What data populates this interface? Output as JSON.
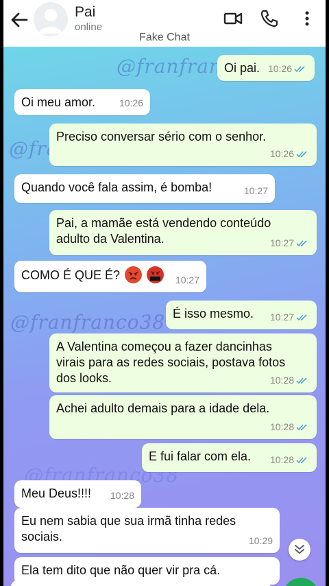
{
  "header": {
    "contact_name": "Pai",
    "status": "online",
    "subtitle": "Fake Chat"
  },
  "watermarks": [
    "@franfranco",
    "@fran",
    "@franfranco38",
    "@franfranco38"
  ],
  "messages": [
    {
      "dir": "out",
      "text": "Oi pai.",
      "time": "10:26"
    },
    {
      "dir": "in",
      "text": "Oi meu amor.",
      "time": "10:26"
    },
    {
      "dir": "out",
      "text": "Preciso conversar sério com o senhor.",
      "time": "10:26"
    },
    {
      "dir": "in",
      "text": "Quando você fala assim, é bomba!",
      "time": "10:27"
    },
    {
      "dir": "out",
      "text": "Pai, a mamãe está vendendo conteúdo adulto da Valentina.",
      "time": "10:27"
    },
    {
      "dir": "in",
      "text": "COMO É QUE É?",
      "time": "10:27",
      "emojis": [
        "angry-face-icon",
        "face-with-symbols-icon"
      ]
    },
    {
      "dir": "out",
      "text": "É isso mesmo.",
      "time": "10:27"
    },
    {
      "dir": "out",
      "text": "A Valentina começou a fazer dancinhas virais para as redes sociais, postava fotos dos looks.",
      "time": "10:28"
    },
    {
      "dir": "out",
      "text": "Achei adulto demais para a idade dela.",
      "time": "10:28"
    },
    {
      "dir": "out",
      "text": "E fui falar com ela.",
      "time": "10:28"
    },
    {
      "dir": "in",
      "text": "Meu Deus!!!!",
      "time": "10:28"
    },
    {
      "dir": "in",
      "text": "Eu nem sabia que sua irmã tinha redes sociais.",
      "time": "10:29"
    },
    {
      "dir": "in",
      "text": "Ela tem dito que não quer vir pra cá.",
      "time": ""
    }
  ],
  "colors": {
    "incoming_bubble": "#ffffff",
    "outgoing_bubble": "#eefee0",
    "read_ticks": "#4fa3e0",
    "fab": "#1faa5a"
  }
}
